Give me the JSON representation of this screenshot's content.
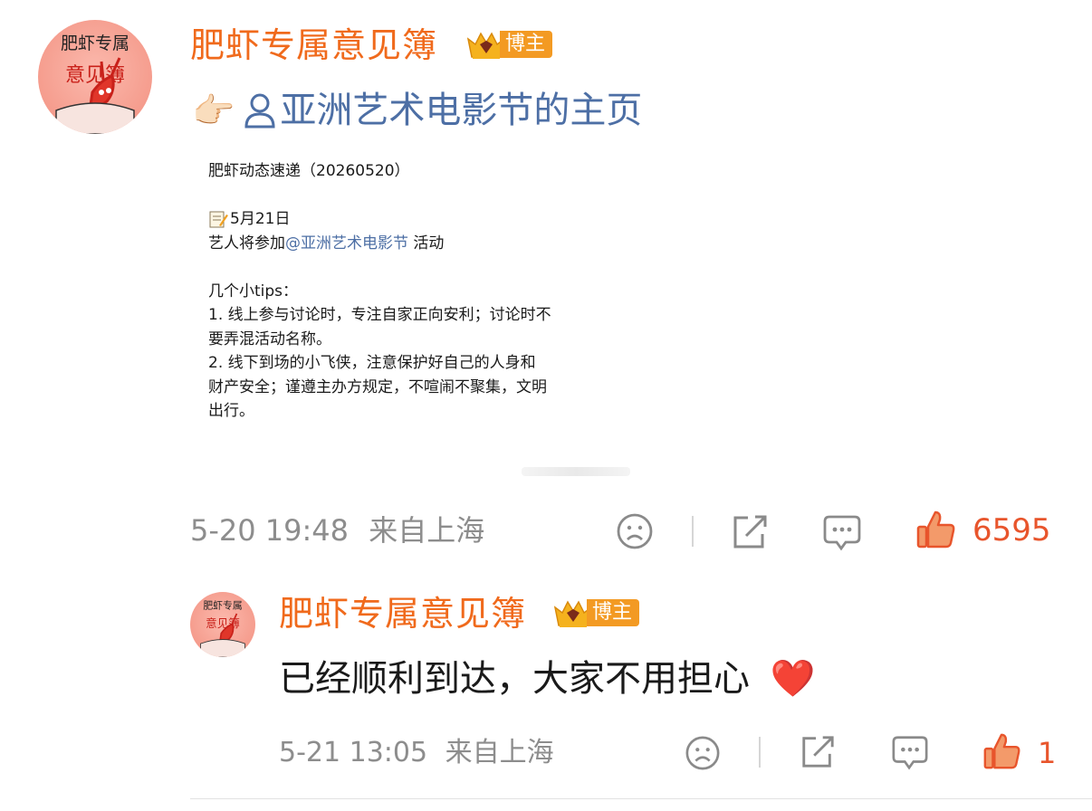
{
  "post": {
    "author": "肥虾专属意见簿",
    "badge": "博主",
    "avatar_text_top": "肥虾专属",
    "avatar_text_bottom": "意见簿",
    "pointing_emoji": "👉🏻",
    "user_link": "亚洲艺术电影节的主页",
    "image_text": {
      "title": "肥虾动态速递（20260520）",
      "date_line": "5月21日",
      "line_pre": "艺人将参加",
      "mention": "@亚洲艺术电影节",
      "line_post": " 活动",
      "tips_header": "几个小tips：",
      "tip1_a": "1. 线上参与讨论时，专注自家正向安利；讨论时不",
      "tip1_b": "要弄混活动名称。",
      "tip2_a": "2. 线下到场的小飞侠，注意保护好自己的人身和",
      "tip2_b": "财产安全；谨遵主办方规定，不喧闹不聚集，文明",
      "tip2_c": "出行。"
    },
    "timestamp": "5-20 19:48",
    "location": "来自上海",
    "like_count": "6595"
  },
  "comment": {
    "author": "肥虾专属意见簿",
    "badge": "博主",
    "text": "已经顺利到达，大家不用担心",
    "emoji": "❤️",
    "timestamp": "5-21 13:05",
    "location": "来自上海",
    "like_count": "1"
  },
  "colors": {
    "username": "#f06a1c",
    "link": "#4d6fa5",
    "badge": "#f39a23",
    "like": "#e8552c",
    "meta": "#8d8d8d"
  },
  "icons": {
    "dislike": "frown-face-icon",
    "share": "share-icon",
    "comment": "comment-icon",
    "like": "thumbs-up-icon",
    "user": "user-icon",
    "memo": "memo-icon",
    "crown": "crown-icon"
  }
}
